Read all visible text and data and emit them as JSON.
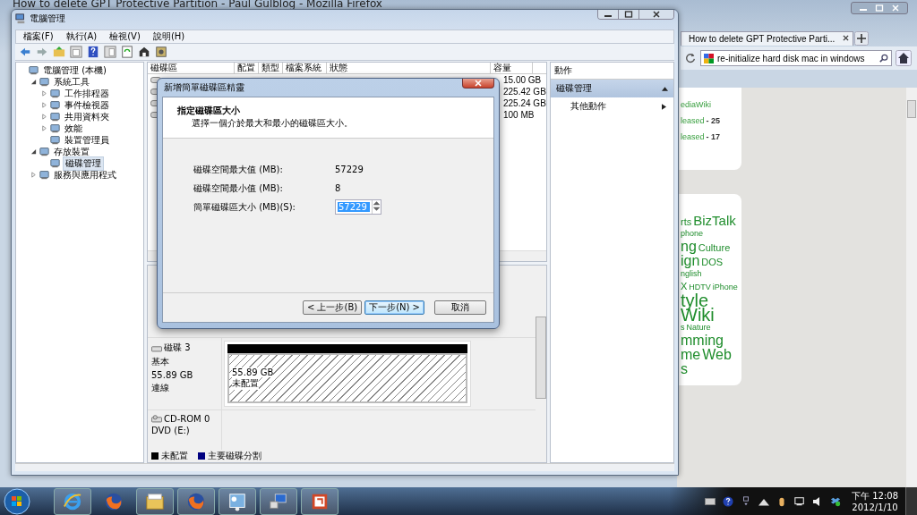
{
  "browser": {
    "title": "How to delete GPT Protective Partition - Paul Gulblog - Mozilla Firefox",
    "tab": {
      "label": "How to delete GPT Protective Parti...",
      "selected": true
    },
    "search": {
      "value": "re-initialize hard disk mac in windows"
    },
    "card_lines": [
      {
        "link": "ediaWiki"
      },
      {
        "link": "leased",
        "count": "- 25"
      },
      {
        "link": "leased",
        "count": "- 17"
      }
    ],
    "tag_cloud": [
      {
        "words": [
          {
            "text": "rts",
            "kind": "m"
          },
          {
            "text": "BizTalk",
            "kind": "l"
          }
        ]
      },
      {
        "words": [
          {
            "text": "phone",
            "kind": "s"
          }
        ]
      },
      {
        "words": [
          {
            "text": "ng",
            "kind": "xl"
          },
          {
            "text": "Culture",
            "kind": "m"
          }
        ]
      },
      {
        "words": [
          {
            "text": "ign",
            "kind": "xl"
          },
          {
            "text": "DOS",
            "kind": "m"
          }
        ]
      },
      {
        "words": [
          {
            "text": "nglish",
            "kind": "s"
          }
        ]
      },
      {
        "words": [
          {
            "text": "X",
            "kind": "m"
          },
          {
            "text": "HDTV",
            "kind": "s"
          },
          {
            "text": "iPhone",
            "kind": "s"
          }
        ]
      },
      {
        "words": [
          {
            "text": "tyle",
            "kind": "xxl"
          }
        ]
      },
      {
        "words": [
          {
            "text": "Wiki",
            "kind": "xxl"
          }
        ]
      },
      {
        "words": [
          {
            "text": "s",
            "kind": "s"
          },
          {
            "text": "Nature",
            "kind": "s"
          }
        ]
      },
      {
        "words": [
          {
            "text": "mming",
            "kind": "xl"
          }
        ]
      },
      {
        "words": [
          {
            "text": "me",
            "kind": "xl"
          },
          {
            "text": "Web",
            "kind": "xl"
          }
        ]
      },
      {
        "words": [
          {
            "text": "s",
            "kind": "xl"
          }
        ]
      }
    ]
  },
  "manager": {
    "title": "電腦管理",
    "menu": [
      "檔案(F)",
      "執行(A)",
      "檢視(V)",
      "說明(H)"
    ],
    "tree": [
      {
        "label": "電腦管理 (本機)",
        "selected": false,
        "children": [
          {
            "label": "系統工具",
            "selected": false,
            "expanded": true,
            "children": [
              {
                "label": "工作排程器",
                "selected": false,
                "expanded": false
              },
              {
                "label": "事件檢視器",
                "selected": false,
                "expanded": false
              },
              {
                "label": "共用資料夾",
                "selected": false,
                "expanded": false
              },
              {
                "label": "效能",
                "selected": false,
                "expanded": false
              },
              {
                "label": "裝置管理員",
                "selected": false
              }
            ]
          },
          {
            "label": "存放裝置",
            "selected": false,
            "expanded": true,
            "children": [
              {
                "label": "磁碟管理",
                "selected": true
              }
            ]
          },
          {
            "label": "服務與應用程式",
            "selected": false,
            "expanded": false
          }
        ]
      }
    ],
    "table": {
      "columns": [
        "磁碟區",
        "配置",
        "類型",
        "檔案系統",
        "狀態",
        "容量"
      ],
      "rows": [
        {
          "capacity": "15.00 GB"
        },
        {
          "capacity": "225.42 GB"
        },
        {
          "capacity": "225.24 GB"
        },
        {
          "capacity": "100 MB"
        }
      ]
    },
    "disks": [
      {
        "kind": "disk",
        "name": "磁碟 3",
        "type": "基本",
        "size": "55.89 GB",
        "status": "連線",
        "partitions": [
          {
            "kind": "unallocated",
            "size": "55.89 GB",
            "label": "未配置"
          }
        ]
      },
      {
        "kind": "cdrom",
        "name": "CD-ROM 0",
        "type": "DVD (E:)"
      }
    ],
    "legend": [
      {
        "label": "未配置",
        "color": "#000000"
      },
      {
        "label": "主要磁碟分割",
        "color": "#000080"
      }
    ],
    "actions": {
      "header": "動作",
      "groups": [
        {
          "label": "磁碟管理",
          "expanded": true,
          "items": [
            "其他動作"
          ]
        }
      ]
    }
  },
  "dialog": {
    "title": "新增簡單磁碟區精靈",
    "heading": "指定磁碟區大小",
    "subtitle": "選擇一個介於最大和最小的磁碟區大小。",
    "fields": [
      {
        "kind": "readonly",
        "label": "磁碟空間最大值 (MB):",
        "value": "57229"
      },
      {
        "kind": "readonly",
        "label": "磁碟空間最小值 (MB):",
        "value": "8"
      },
      {
        "kind": "spin",
        "label": "簡單磁碟區大小 (MB)(S):",
        "value": "57229"
      }
    ],
    "buttons": [
      {
        "label": "< 上一步(B)",
        "default": false
      },
      {
        "label": "下一步(N) >",
        "default": true
      },
      {
        "label": "取消",
        "default": false
      }
    ]
  },
  "taskbar": {
    "apps": [
      {
        "kind": "ie",
        "running": true
      },
      {
        "kind": "firefox",
        "running": false
      },
      {
        "kind": "explorer",
        "running": true
      },
      {
        "kind": "firefox",
        "running": true
      },
      {
        "kind": "control",
        "running": true
      },
      {
        "kind": "network",
        "running": true
      },
      {
        "kind": "slides",
        "running": true
      }
    ],
    "time": "下午 12:08",
    "date": "2012/1/10"
  }
}
